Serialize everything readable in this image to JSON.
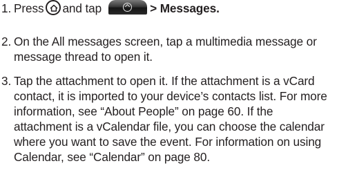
{
  "steps": [
    {
      "number": "1.",
      "text_before_home": "Press",
      "home_icon": "home-icon",
      "text_between": "and tap",
      "app_icon": "applications-tab-icon",
      "arrow": ">",
      "target": "Messages."
    },
    {
      "number": "2.",
      "text": "On the All messages screen, tap a multimedia message or message thread to open it."
    },
    {
      "number": "3.",
      "text": "Tap the attachment to open it. If the attachment is a vCard contact, it is imported to your device’s contacts list. For more information, see “About People” on page 60. If the attachment is a vCalendar file, you can choose the calendar where you want to save the event. For information on using Calendar, see “Calendar” on page 80."
    }
  ]
}
